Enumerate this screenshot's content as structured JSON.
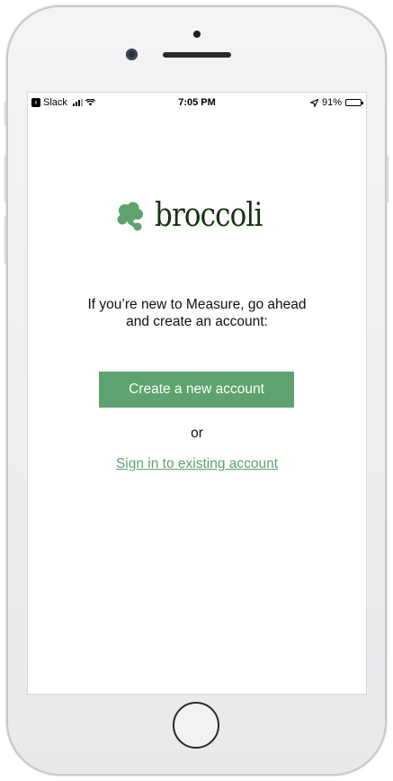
{
  "statusbar": {
    "back_app": "Slack",
    "time": "7:05 PM",
    "battery": "91%",
    "battery_level": 0.91
  },
  "brand": {
    "name": "broccoli",
    "icon": "broccoli-icon",
    "color": "#17330f",
    "icon_color": "#5fa26f"
  },
  "intro": {
    "line1": "If you’re new to Measure, go ahead",
    "line2": "and create an account:"
  },
  "actions": {
    "create_label": "Create a new account",
    "or_label": "or",
    "signin_label": "Sign in to existing account",
    "accent": "#5fa26f"
  }
}
